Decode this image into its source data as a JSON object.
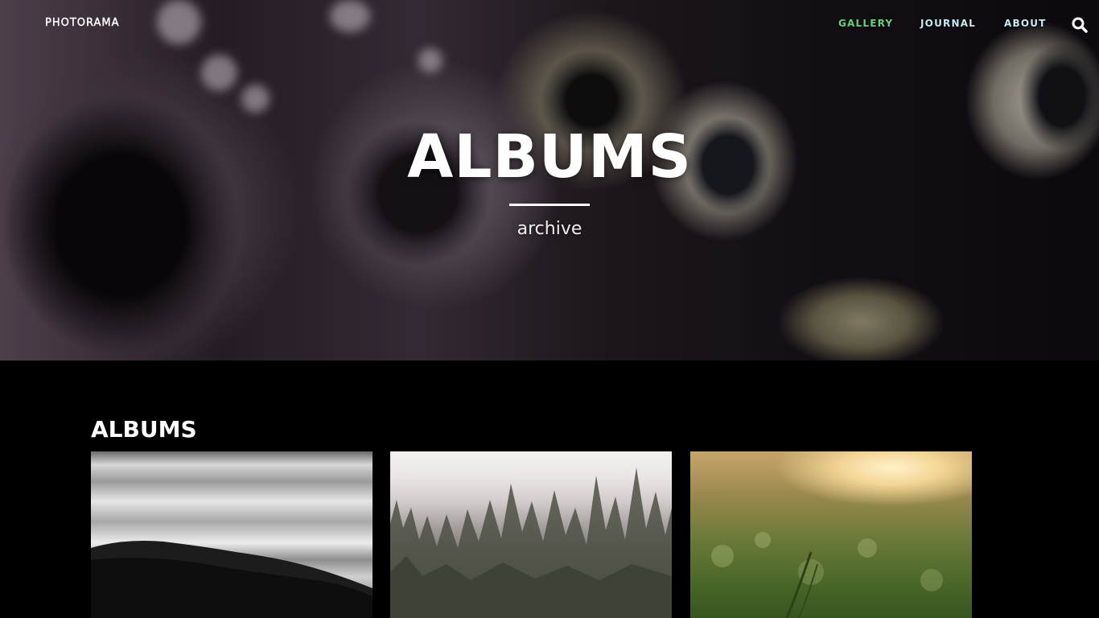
{
  "brand": {
    "logo_text": "PHOTORAMA"
  },
  "nav": {
    "items": [
      {
        "label": "GALLERY",
        "active": true
      },
      {
        "label": "JOURNAL",
        "active": false
      },
      {
        "label": "ABOUT",
        "active": false
      }
    ],
    "search_icon": "search-icon"
  },
  "hero": {
    "title": "ALBUMS",
    "subtitle": "archive"
  },
  "section": {
    "title": "ALBUMS",
    "albums": [
      {
        "image": "fog-over-hills-bw"
      },
      {
        "image": "misty-pine-forest"
      },
      {
        "image": "dewy-grass-sunset"
      }
    ]
  },
  "colors": {
    "accent_active": "#66d17a",
    "nav_link": "#c7e9f1",
    "background": "#000000"
  }
}
